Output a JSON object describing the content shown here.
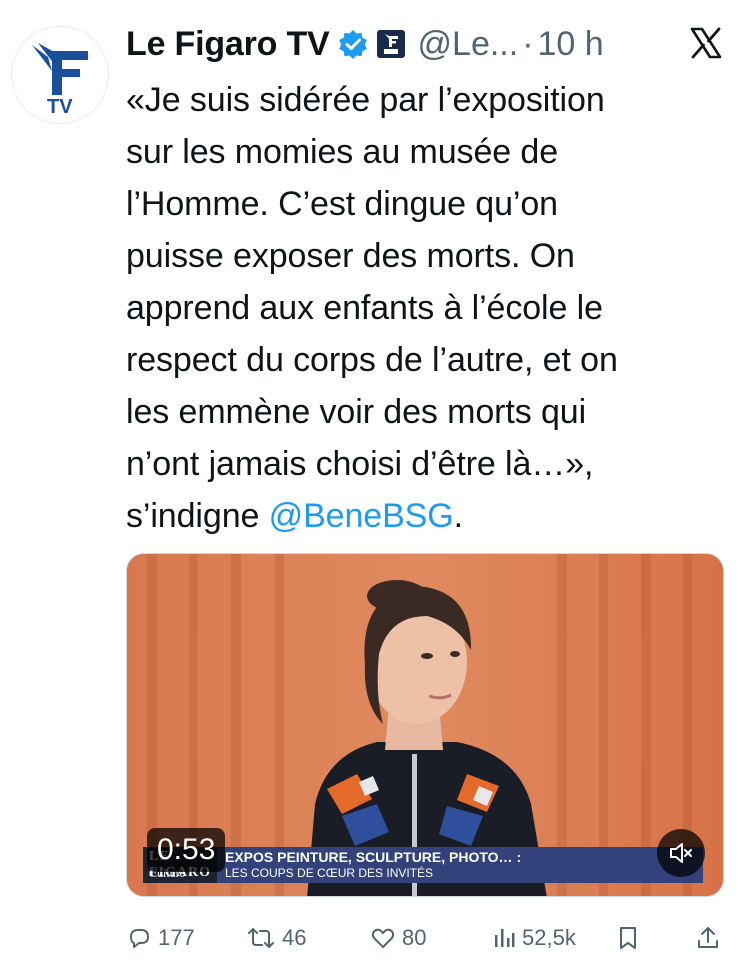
{
  "author": {
    "name": "Le Figaro TV",
    "handle": "@Le...",
    "separator": "·",
    "time": "10 h",
    "avatar_text": "TV"
  },
  "tweet": {
    "lines": [
      "«Je suis sidérée par l’exposition",
      "sur les momies au musée de",
      "l’Homme. C’est dingue qu’on",
      "puisse exposer des morts. On",
      "apprend aux enfants à l’école le",
      "respect du corps de l’autre, et on",
      "les emmène voir des morts qui",
      "n’ont jamais choisi d’être là…»,"
    ],
    "last_line_prefix": "s’indigne ",
    "mention": "@BeneBSG",
    "last_line_suffix": "."
  },
  "video": {
    "duration": "0:53",
    "lower_third": {
      "logo_line1": "LE FIGARO",
      "logo_line2": "Culture",
      "headline": "EXPOS PEINTURE, SCULPTURE, PHOTO… :",
      "subheadline": "LES COUPS DE CŒUR DES INVITÉS"
    }
  },
  "actions": {
    "replies": "177",
    "reposts": "46",
    "likes": "80",
    "views": "52,5k"
  },
  "colors": {
    "text": "#0f1419",
    "secondary": "#536471",
    "accent": "#1d9bf0",
    "figaro_blue": "#1a4f9c"
  }
}
